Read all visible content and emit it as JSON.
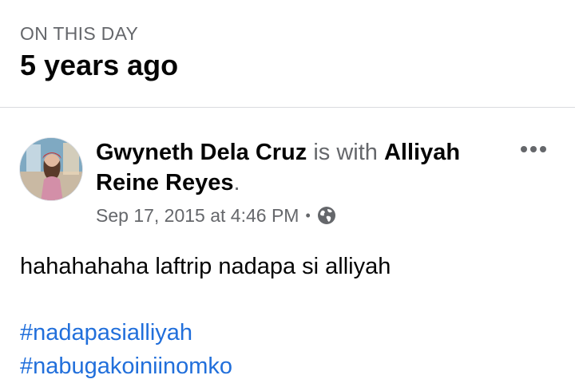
{
  "memory": {
    "overline": "ON THIS DAY",
    "years_ago": "5 years ago"
  },
  "post": {
    "author": "Gwyneth Dela Cruz",
    "with_text": "is with",
    "tagged_user": "Alliyah Reine Reyes",
    "tagged_suffix": ".",
    "timestamp": "Sep 17, 2015 at 4:46 PM",
    "separator": "•",
    "privacy_icon": "globe-icon",
    "more_icon": "more-horizontal-icon",
    "text": "hahahahaha laftrip nadapa si alliyah",
    "hashtags": [
      "#nadapasialliyah",
      "#nabugakoiniinomko"
    ]
  },
  "colors": {
    "muted": "#65676b",
    "link": "#216fdb",
    "text": "#050505",
    "divider": "#d9dbdf"
  }
}
